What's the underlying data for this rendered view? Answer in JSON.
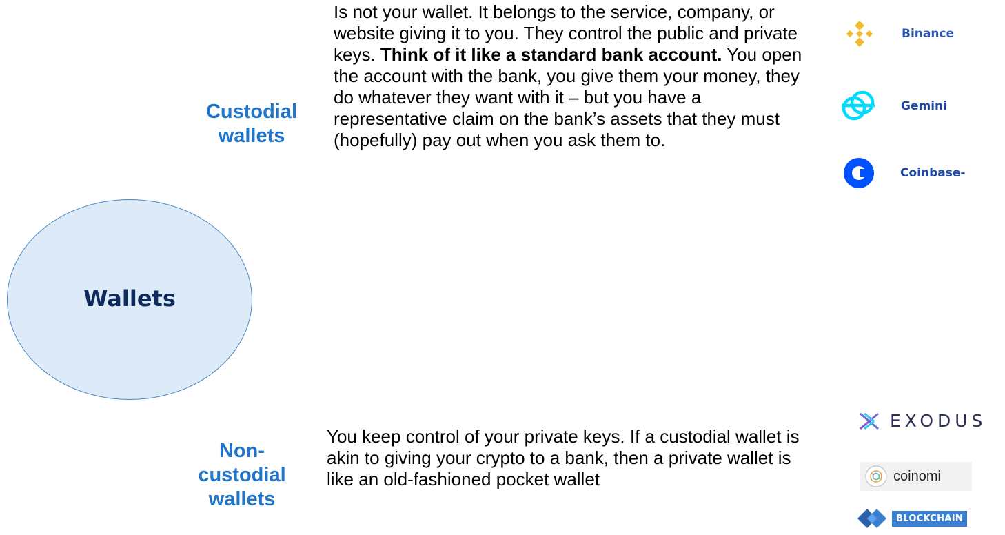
{
  "center": {
    "title": "Wallets"
  },
  "custodial": {
    "label_line1": "Custodial",
    "label_line2": "wallets",
    "desc_part1": "Is not your wallet. It belongs to the service, company, or website giving it to you. They control the public and private keys. ",
    "desc_bold": "Think of it like a standard bank account.",
    "desc_part2": " You open the account with the bank, you give them your money, they do whatever they want with it – but you have a representative claim on the bank’s assets that they must (hopefully) pay out when you ask them to.",
    "logos": [
      {
        "name": "Binance",
        "icon": "binance-icon",
        "color": "#f3ba2f"
      },
      {
        "name": "Gemini",
        "icon": "gemini-icon",
        "color": "#00dcfa"
      },
      {
        "name": "Coinbase-",
        "icon": "coinbase-icon",
        "color": "#0052ff"
      }
    ]
  },
  "noncustodial": {
    "label_line1": "Non-",
    "label_line2": "custodial",
    "label_line3": "wallets",
    "desc": "You keep control of your private keys. If a custodial wallet is akin to giving your crypto to a bank, then a private wallet is like an old-fashioned pocket wallet",
    "logos": [
      {
        "name": "EXODUS",
        "icon": "exodus-icon"
      },
      {
        "name": "coinomi",
        "icon": "coinomi-icon"
      },
      {
        "name": "BLOCKCHAIN",
        "icon": "blockchain-icon",
        "color": "#3b7fd1"
      }
    ]
  },
  "colors": {
    "label_blue": "#1f75c9",
    "ellipse_fill": "#dcebf7",
    "ellipse_border": "#4a86c5",
    "title_navy": "#0f2a5c"
  }
}
